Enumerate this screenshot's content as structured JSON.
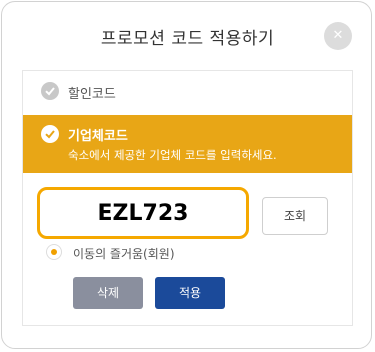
{
  "modal": {
    "title": "프로모션 코드 적용하기",
    "close_glyph": "✕"
  },
  "options": {
    "discount_label": "할인코드",
    "corporate_label": "기업체코드",
    "corporate_description": "숙소에서 제공한 기업체 코드를 입력하세요."
  },
  "code_input": {
    "value": "EZL723"
  },
  "lookup_button": "조회",
  "radio": {
    "label": "이동의 즐거움(회원)",
    "selected": true
  },
  "actions": {
    "delete_label": "삭제",
    "apply_label": "적용"
  },
  "colors": {
    "accent": "#e8a616",
    "input_border": "#f5a800",
    "apply_button": "#1b4a9a",
    "delete_button": "#8a8f9e"
  }
}
